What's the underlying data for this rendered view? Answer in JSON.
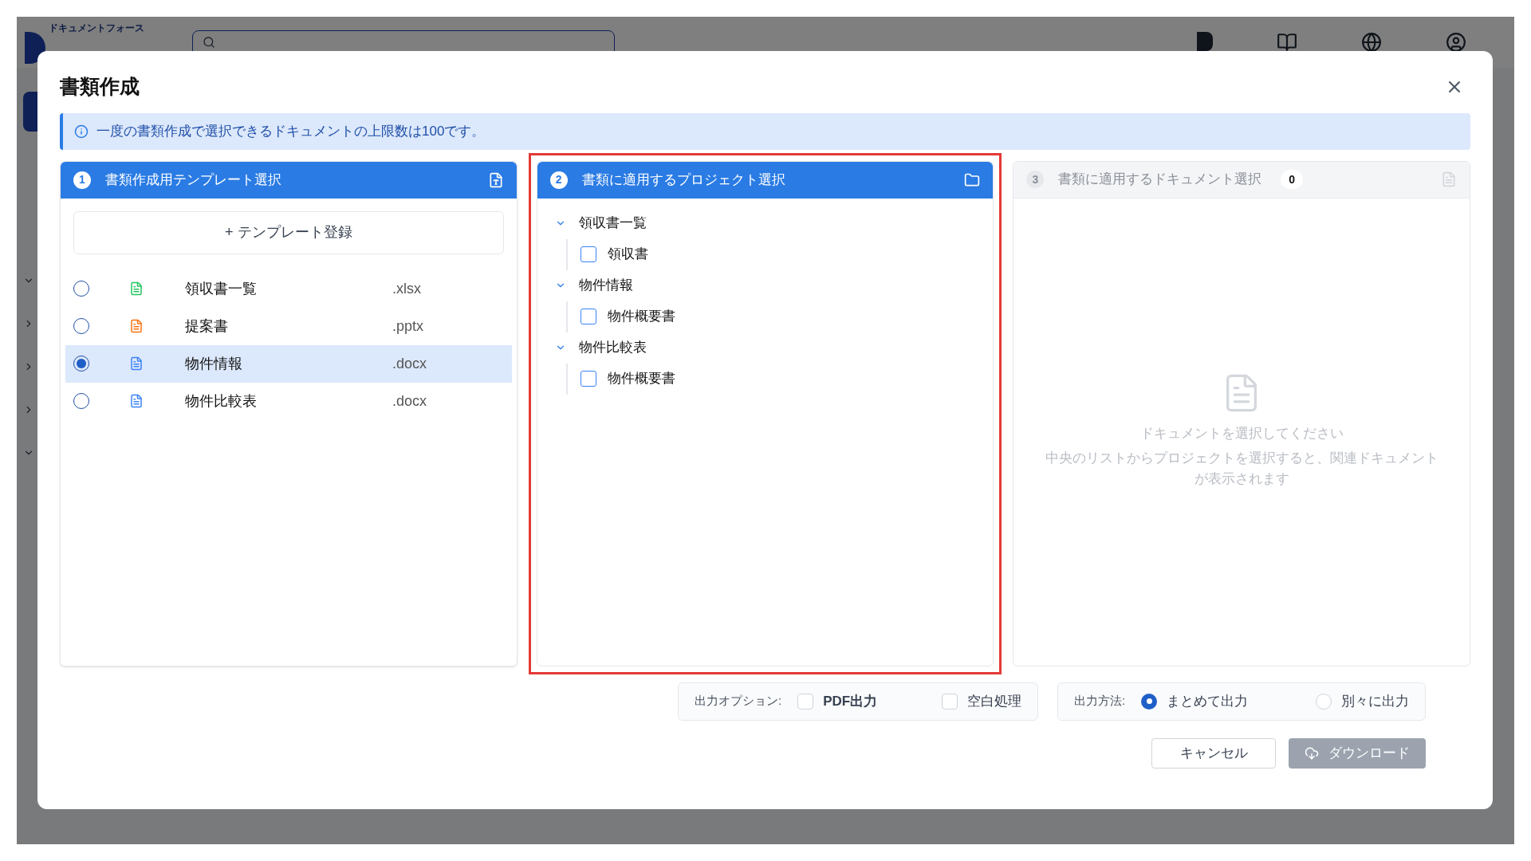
{
  "background_app": {
    "logo_text": "ドキュメントフォース"
  },
  "dialog": {
    "title": "書類作成"
  },
  "info_banner": {
    "text": "一度の書類作成で選択できるドキュメントの上限数は100です。"
  },
  "template_panel": {
    "step": "1",
    "title": "書類作成用テンプレート選択",
    "enabled": true,
    "add_button": "+ テンプレート登録",
    "templates": [
      {
        "name": "領収書一覧",
        "ext": ".xlsx",
        "selected": false,
        "color": "#22c55e"
      },
      {
        "name": "提案書",
        "ext": ".pptx",
        "selected": false,
        "color": "#f97316"
      },
      {
        "name": "物件情報",
        "ext": ".docx",
        "selected": true,
        "color": "#3b82f6"
      },
      {
        "name": "物件比較表",
        "ext": ".docx",
        "selected": false,
        "color": "#3b82f6"
      }
    ]
  },
  "project_panel": {
    "step": "2",
    "title": "書類に適用するプロジェクト選択",
    "enabled": true,
    "highlighted": true,
    "tree": [
      {
        "label": "領収書一覧",
        "expanded": true,
        "children": [
          {
            "label": "領収書",
            "checked": false
          }
        ]
      },
      {
        "label": "物件情報",
        "expanded": true,
        "children": [
          {
            "label": "物件概要書",
            "checked": false
          }
        ]
      },
      {
        "label": "物件比較表",
        "expanded": true,
        "children": [
          {
            "label": "物件概要書",
            "checked": false
          }
        ]
      }
    ]
  },
  "document_panel": {
    "step": "3",
    "title": "書類に適用するドキュメント選択",
    "enabled": false,
    "count": "0",
    "empty_title": "ドキュメントを選択してください",
    "empty_text": "中央のリストからプロジェクトを選択すると、関連ドキュメントが表示されます"
  },
  "output_options": {
    "label": "出力オプション:",
    "options": [
      {
        "label": "PDF出力",
        "checked": false
      },
      {
        "label": "空白処理",
        "checked": false
      }
    ]
  },
  "output_method": {
    "label": "出力方法:",
    "options": [
      {
        "label": "まとめて出力",
        "selected": true
      },
      {
        "label": "別々に出力",
        "selected": false
      }
    ]
  },
  "buttons": {
    "cancel": {
      "label": "キャンセル"
    },
    "download": {
      "label": "ダウンロード",
      "disabled": true
    }
  }
}
